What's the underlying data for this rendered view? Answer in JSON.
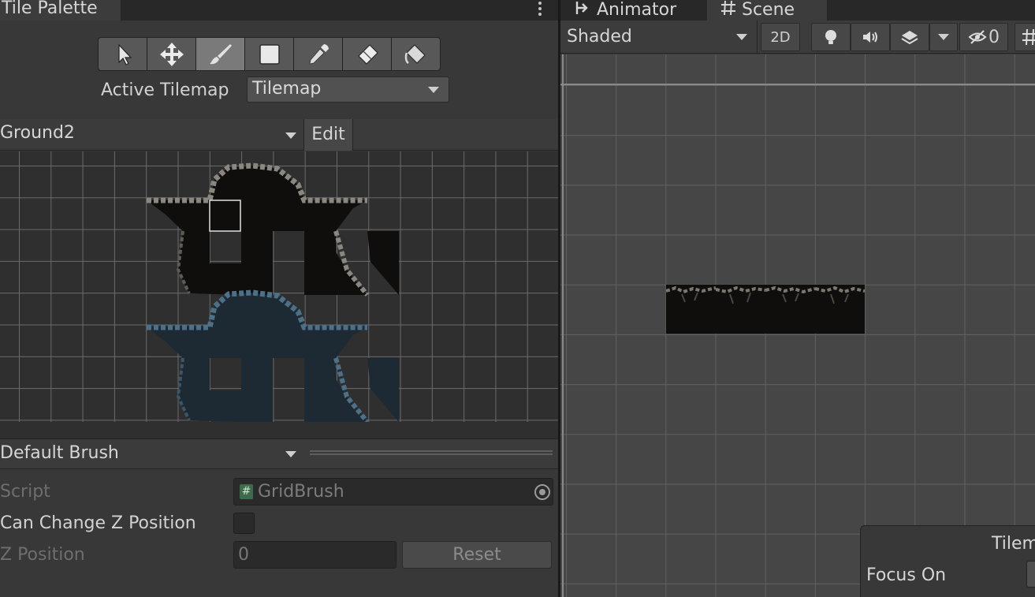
{
  "tile_palette": {
    "tab_title": "Tile Palette",
    "tools": [
      {
        "name": "select-tool",
        "icon": "arrow-cursor-icon",
        "active": false
      },
      {
        "name": "move-tool",
        "icon": "move-arrows-icon",
        "active": false
      },
      {
        "name": "paint-tool",
        "icon": "paintbrush-icon",
        "active": true
      },
      {
        "name": "box-fill-tool",
        "icon": "square-icon",
        "active": false
      },
      {
        "name": "picker-tool",
        "icon": "eyedropper-icon",
        "active": false
      },
      {
        "name": "eraser-tool",
        "icon": "eraser-icon",
        "active": false
      },
      {
        "name": "fill-tool",
        "icon": "paint-bucket-icon",
        "active": false
      }
    ],
    "active_tilemap_label": "Active Tilemap",
    "active_tilemap_value": "Tilemap",
    "palette_name": "Ground2",
    "edit_label": "Edit",
    "brush_name": "Default Brush",
    "properties": {
      "script_label": "Script",
      "script_value": "GridBrush",
      "can_change_z_label": "Can Change Z Position",
      "z_position_label": "Z Position",
      "z_position_value": "0",
      "reset_label": "Reset"
    }
  },
  "scene": {
    "tabs": [
      {
        "label": "Animator",
        "icon": "animator-icon",
        "active": false
      },
      {
        "label": "Scene",
        "icon": "grid-hash-icon",
        "active": true
      }
    ],
    "shading_mode": "Shaded",
    "toggle_2d_label": "2D",
    "hidden_count": "0",
    "overlay": {
      "title": "Tilem",
      "focus_label": "Focus On"
    }
  },
  "colors": {
    "panel": "#383838",
    "toolbar": "#3c3c3c",
    "active_tool": "#7a7a7a",
    "dark_tile": "#0f0e0c",
    "blue_tile": "#1e2a33",
    "rock": "#8a8780"
  }
}
